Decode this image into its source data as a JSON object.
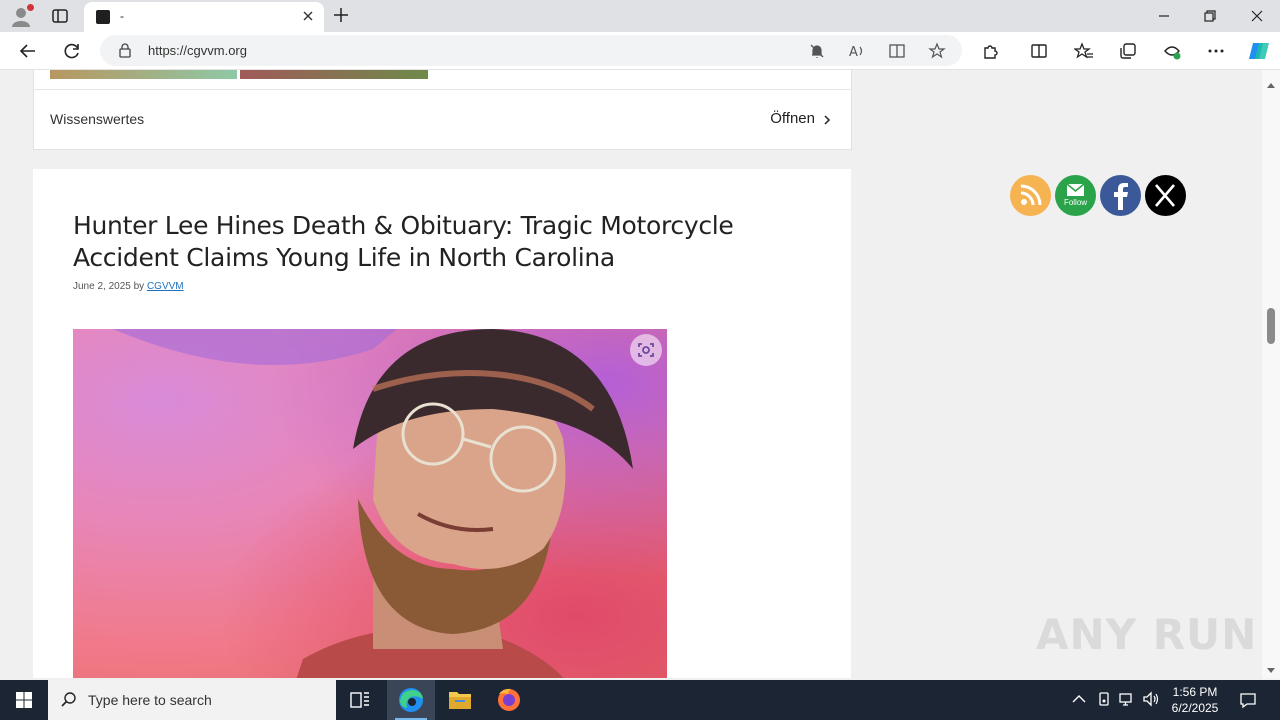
{
  "browser": {
    "tab_title": "-",
    "url": "https://cgvvm.org"
  },
  "page": {
    "prev_card": {
      "label": "Wissenswertes",
      "open_label": "Öffnen"
    },
    "article": {
      "title": "Hunter Lee Hines Death & Obituary: Tragic Motorcycle Accident Claims Young Life in North Carolina",
      "date": "June 2, 2025",
      "by": "by",
      "author": "CGVVM"
    },
    "social": {
      "follow_label": "Follow"
    },
    "watermark": "ANY RUN"
  },
  "taskbar": {
    "search_placeholder": "Type here to search",
    "time": "1:56 PM",
    "date": "6/2/2025"
  }
}
